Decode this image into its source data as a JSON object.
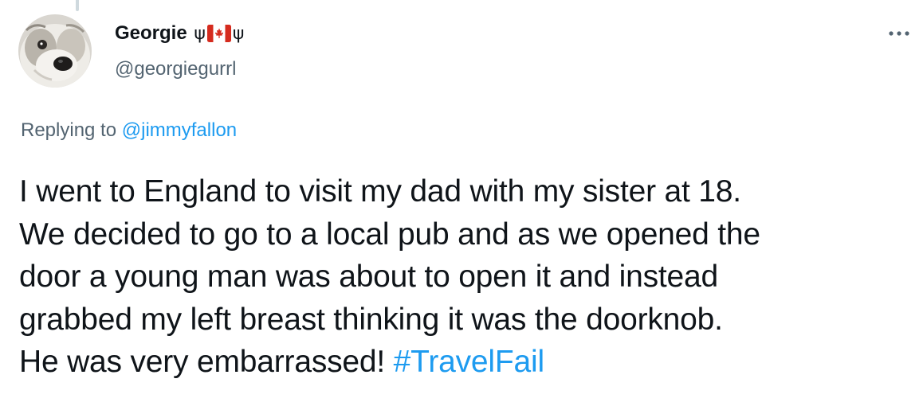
{
  "tweet": {
    "author": {
      "display_name": "Georgie",
      "name_emoji_left": "ψ",
      "name_flag": "canada-flag-icon",
      "name_emoji_right": "ψ",
      "handle": "@georgiegurrl",
      "avatar_icon": "dog-avatar"
    },
    "replying_to": {
      "prefix": "Replying to",
      "handle": "@jimmyfallon"
    },
    "text_lines": [
      "I went to England to visit my dad with my sister at 18.",
      "We decided to go to a local pub and as we opened the",
      "door a young man was about to open it and instead",
      "grabbed my left breast thinking it was the doorknob.",
      "He was very embarrassed!"
    ],
    "hashtag": "#TravelFail",
    "more_icon": "more-options-icon"
  },
  "colors": {
    "text": "#0f1419",
    "secondary": "#536471",
    "link": "#1d9bf0",
    "thread_line": "#cfd9de",
    "flag_red": "#d52b1e"
  }
}
